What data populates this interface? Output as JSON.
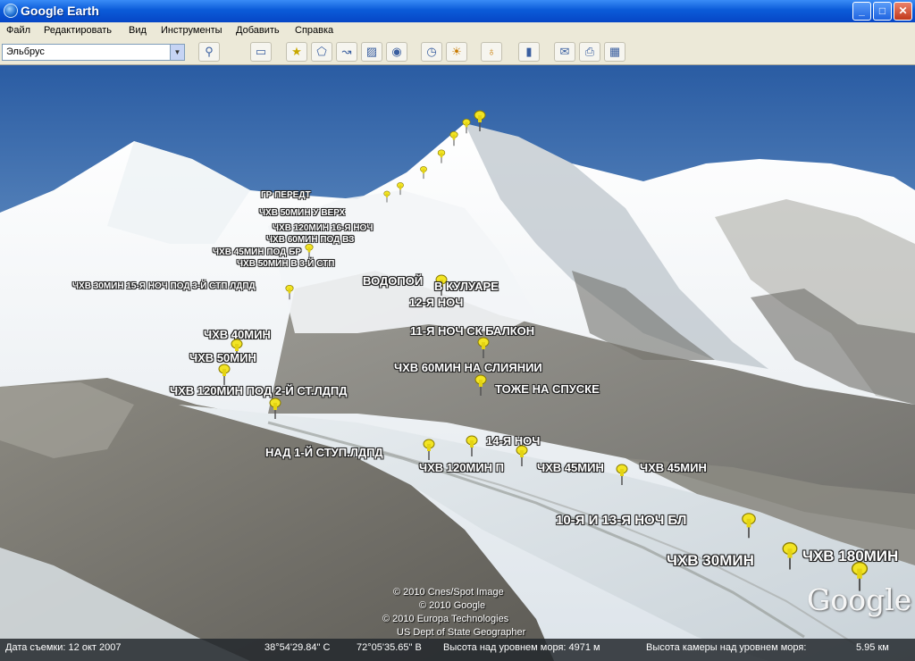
{
  "window": {
    "title": "Google Earth"
  },
  "menu": [
    "Файл",
    "Редактировать",
    "Вид",
    "Инструменты",
    "Добавить",
    "Справка"
  ],
  "search": {
    "value": "Эльбрус"
  },
  "toolbar_icons": [
    "search-icon",
    "sidebar-toggle-icon",
    "placemark-icon",
    "polygon-icon",
    "path-icon",
    "image-overlay-icon",
    "record-tour-icon",
    "historical-imagery-icon",
    "sunlight-icon",
    "planets-icon",
    "ruler-icon",
    "email-icon",
    "print-icon",
    "view-in-maps-icon"
  ],
  "labels": {
    "gr_peredt": "ГР ПЕРЕДТ",
    "chv50_verh": "ЧХВ 50МИН У ВЕРХ",
    "chv120_16": "ЧХВ 120МИН 16-Я  НОЧ",
    "chv60_pod_vz": "ЧХВ 60МИН ПОД ВЗ",
    "chv45_pod_br": "ЧХВ 45МИН ПОД БР",
    "chv50_3stp": "ЧХВ 50МИН В 3-Й СТП",
    "chv30_15": "ЧХВ 30МИН 15-Я  НОЧ ПОД 3-Й СТП ЛДПД",
    "vodopoy": "ВОДОПОЙ",
    "v_kuluare": "В КУЛУАРЕ",
    "n12": "12-Я НОЧ",
    "n11": "11-Я НОЧ СК БАЛКОН",
    "chv40": "ЧХВ 40МИН",
    "chv50": "ЧХВ 50МИН",
    "chv60_sliyanii": "ЧХВ 60МИН НА СЛИЯНИИ",
    "tozhe": "ТОЖЕ НА СПУСКЕ",
    "chv120_2st": "ЧХВ 120МИН ПОД 2-Й СТ.ЛДПД",
    "n14": "14-Я НОЧ",
    "nad1": "НАД 1-Й СТУП.ЛДПД",
    "chv120p": "ЧХВ 120МИН П",
    "chv45_a": "ЧХВ 45МИН",
    "chv45_b": "ЧХВ 45МИН",
    "n10_13": "10-Я И 13-Я НОЧ БЛ",
    "chv30": "ЧХВ 30МИН",
    "chv180": "ЧХВ 180МИН"
  },
  "copyright": [
    "© 2010 Cnes/Spot Image",
    "© 2010 Google",
    "© 2010 Europa Technologies",
    "US Dept of State Geographer"
  ],
  "logo": "Google",
  "status": {
    "date": "Дата съемки: 12 окт 2007",
    "lat": "38°54'29.84\" С",
    "lon": "72°05'35.65\" В",
    "elev": "Высота над уровнем моря:  4971 м",
    "eye": "Высота камеры над уровнем моря:",
    "eye_val": "5.95 км"
  },
  "colors": {
    "titlebar": "#0b5bd8",
    "sky_top": "#2c5fa6",
    "pin": "#f2e424"
  }
}
